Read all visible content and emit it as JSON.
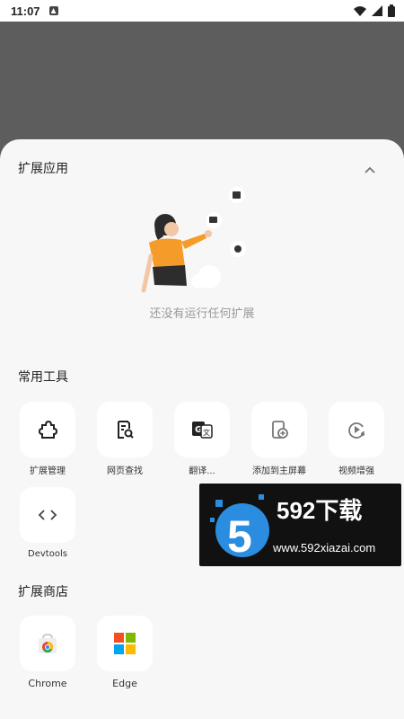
{
  "statusbar": {
    "time": "11:07"
  },
  "extensions": {
    "title": "扩展应用",
    "empty_text": "还没有运行任何扩展"
  },
  "tools": {
    "title": "常用工具",
    "items": [
      {
        "label": "扩展管理",
        "icon": "puzzle-icon"
      },
      {
        "label": "网页查找",
        "icon": "page-search-icon"
      },
      {
        "label": "翻译...",
        "icon": "translate-icon"
      },
      {
        "label": "添加到主屏幕",
        "icon": "add-to-home-icon"
      },
      {
        "label": "视频增强",
        "icon": "video-enhance-icon"
      },
      {
        "label": "Devtools",
        "icon": "code-icon"
      }
    ]
  },
  "store": {
    "title": "扩展商店",
    "items": [
      {
        "label": "Chrome",
        "icon": "chrome-store-icon"
      },
      {
        "label": "Edge",
        "icon": "edge-store-icon"
      }
    ]
  },
  "watermark": {
    "title": "592下载",
    "url": "www.592xiazai.com",
    "accent": "#2a8de0"
  }
}
